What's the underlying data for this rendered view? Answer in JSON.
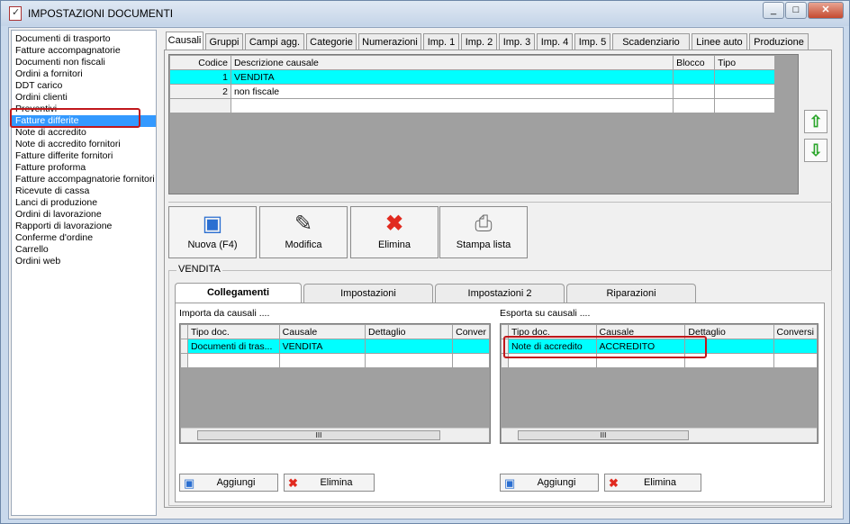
{
  "window": {
    "title": "IMPOSTAZIONI DOCUMENTI",
    "btn_min": "_",
    "btn_max": "□",
    "btn_close": "✕"
  },
  "nav": {
    "items": [
      "Documenti di trasporto",
      "Fatture accompagnatorie",
      "Documenti non fiscali",
      "Ordini a fornitori",
      "DDT carico",
      "Ordini clienti",
      "Preventivi",
      "Fatture differite",
      "Note di accredito",
      "Note di accredito fornitori",
      "Fatture differite fornitori",
      "Fatture proforma",
      "Fatture accompagnatorie fornitori",
      "Ricevute di cassa",
      "Lanci di produzione",
      "Ordini di lavorazione",
      "Rapporti di lavorazione",
      "Conferme d'ordine",
      "Carrello",
      "Ordini web"
    ],
    "selected": "Fatture differite"
  },
  "tabs": [
    "Causali",
    "Gruppi",
    "Campi agg.",
    "Categorie",
    "Numerazioni",
    "Imp. 1",
    "Imp. 2",
    "Imp. 3",
    "Imp. 4",
    "Imp. 5",
    "Scadenziario",
    "Linee auto",
    "Produzione"
  ],
  "causali_grid": {
    "headers": [
      "Codice",
      "Descrizione causale",
      "Blocco",
      "Tipo"
    ],
    "rows": [
      {
        "codice": "1",
        "descrizione": "VENDITA",
        "blocco": "",
        "tipo": ""
      },
      {
        "codice": "2",
        "descrizione": "non fiscale",
        "blocco": "",
        "tipo": ""
      }
    ]
  },
  "arrows": {
    "up": "⇧",
    "down": "⇩"
  },
  "toolbar": {
    "new": "Nuova (F4)",
    "edit": "Modifica",
    "delete": "Elimina",
    "print": "Stampa lista",
    "icon_new": "▣",
    "icon_edit": "✎",
    "icon_delete": "✖",
    "icon_print": "⎙"
  },
  "group": {
    "label": "VENDITA"
  },
  "subtabs": [
    "Collegamenti",
    "Impostazioni",
    "Impostazioni 2",
    "Riparazioni"
  ],
  "importa": {
    "label": "Importa da causali ....",
    "headers": [
      "Tipo doc.",
      "Causale",
      "Dettaglio",
      "Conver"
    ],
    "rows": [
      {
        "tipo": "Documenti di tras...",
        "causale": "VENDITA",
        "dettaglio": "",
        "conv": ""
      }
    ],
    "add": "Aggiungi",
    "remove": "Elimina"
  },
  "esporta": {
    "label": "Esporta su causali ....",
    "headers": [
      "Tipo doc.",
      "Causale",
      "Dettaglio",
      "Conversi"
    ],
    "rows": [
      {
        "tipo": "Note di accredito",
        "causale": "ACCREDITO",
        "dettaglio": "",
        "conv": ""
      }
    ],
    "add": "Aggiungi",
    "remove": "Elimina"
  },
  "scroll_grip": "III",
  "colors": {
    "selection": "#3399ff",
    "grid_selected": "#00ffff",
    "highlight": "#c0171b"
  }
}
